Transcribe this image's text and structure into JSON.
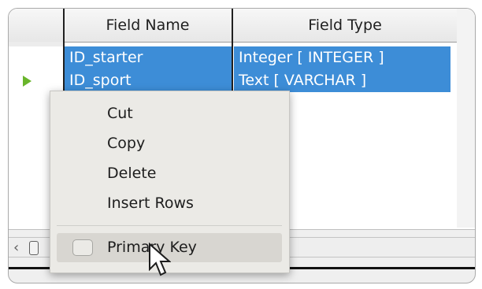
{
  "header": {
    "col1": "Field Name",
    "col2": "Field Type"
  },
  "rows": [
    {
      "name": "ID_starter",
      "type": "Integer [ INTEGER ]"
    },
    {
      "name": "ID_sport",
      "type": "Text [ VARCHAR ]"
    }
  ],
  "context_menu": {
    "items": [
      "Cut",
      "Copy",
      "Delete",
      "Insert Rows"
    ],
    "primary_key": "Primary Key"
  },
  "colors": {
    "selection": "#3d8dd7",
    "row_indicator": "#69b52b"
  },
  "icons": {
    "row_indicator": "play-triangle-icon",
    "cursor": "mouse-pointer-icon"
  }
}
